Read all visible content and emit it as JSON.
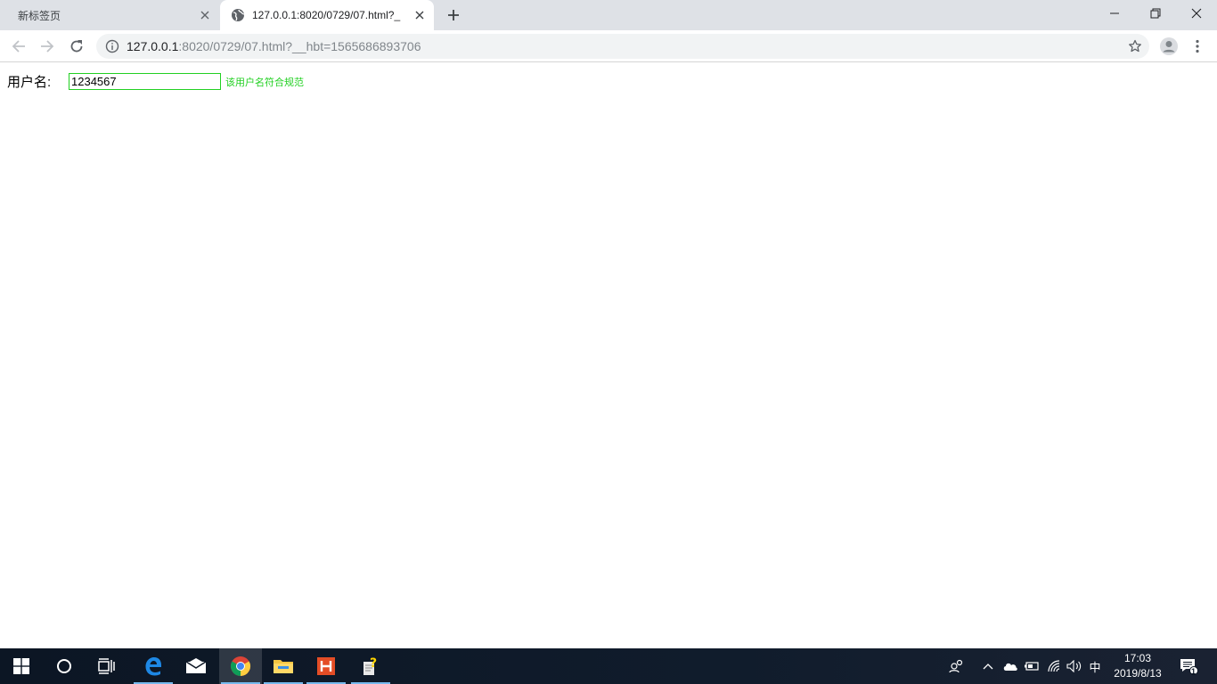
{
  "browser": {
    "tabs": [
      {
        "title": "新标签页",
        "active": false
      },
      {
        "title": "127.0.0.1:8020/0729/07.html?_",
        "active": true
      }
    ],
    "address": {
      "host": "127.0.0.1",
      "rest": ":8020/0729/07.html?__hbt=1565686893706"
    }
  },
  "page": {
    "username_label": "用户名:",
    "username_value": "1234567",
    "validation_message": "该用户名符合规范",
    "accent_color": "#22d022"
  },
  "taskbar": {
    "ime": "中",
    "time": "17:03",
    "date": "2019/8/13",
    "notification_count": "1"
  }
}
